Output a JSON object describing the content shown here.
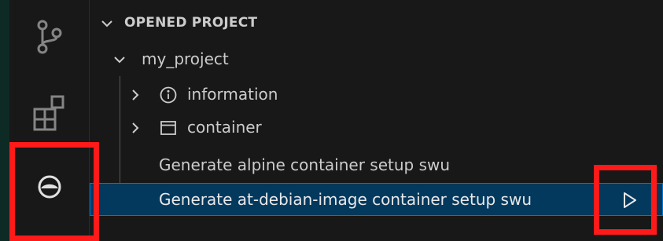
{
  "activity_bar": {
    "icons": [
      "source-control-icon",
      "extensions-icon",
      "atmark-extension-icon"
    ]
  },
  "sidebar": {
    "section_title": "OPENED PROJECT",
    "project": {
      "name": "my_project",
      "children": [
        {
          "label": "information",
          "icon": "info-icon",
          "expanded": false
        },
        {
          "label": "container",
          "icon": "window-icon",
          "expanded": false
        }
      ],
      "actions": [
        {
          "label": "Generate alpine container setup swu",
          "selected": false
        },
        {
          "label": "Generate at-debian-image container setup swu",
          "selected": true
        }
      ]
    }
  },
  "colors": {
    "background": "#181818",
    "selection": "#04395e",
    "selection_border": "#0078d4",
    "highlight": "#ff1a1a",
    "text": "#cccccc"
  }
}
